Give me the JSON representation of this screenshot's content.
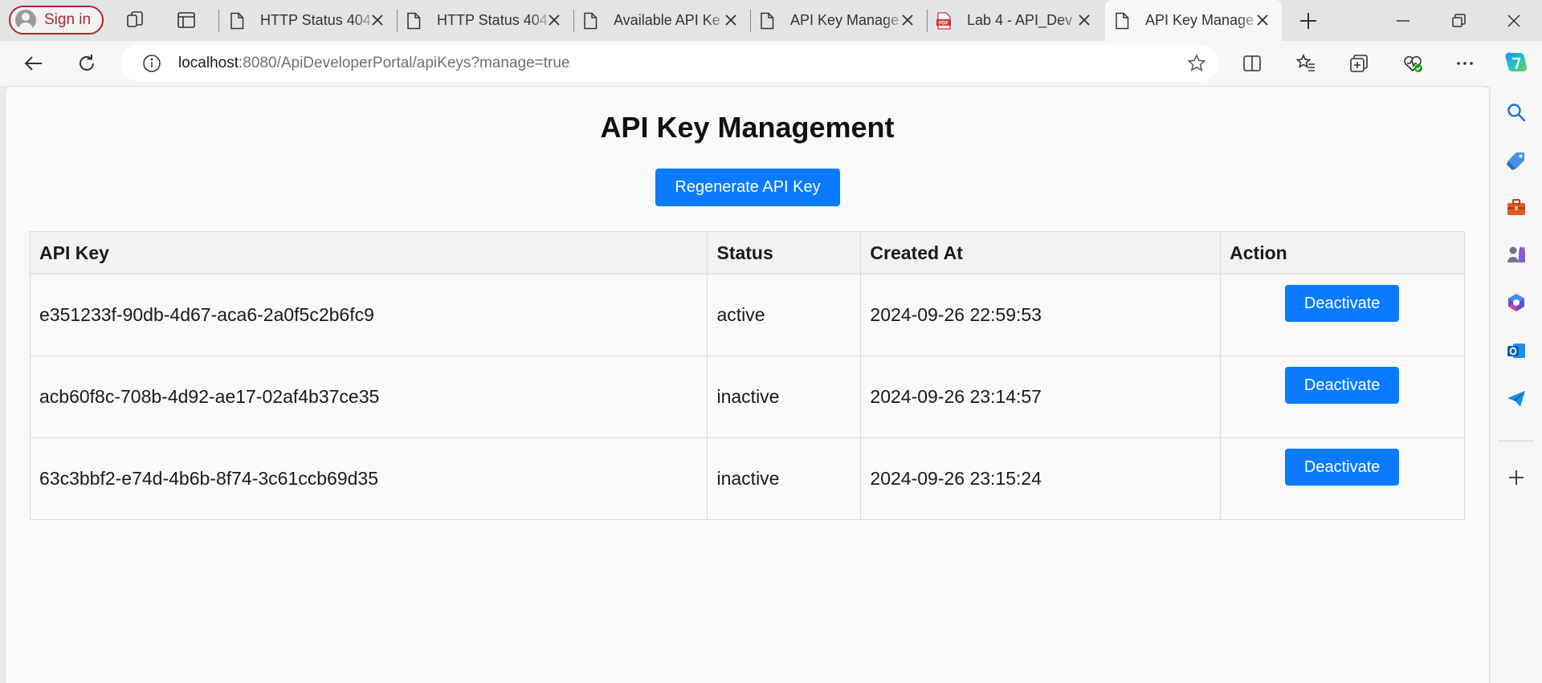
{
  "browser": {
    "profile_label": "Sign in",
    "tabs": [
      {
        "title": "HTTP Status 404",
        "icon": "page-icon"
      },
      {
        "title": "HTTP Status 404",
        "icon": "page-icon"
      },
      {
        "title": "Available API Ke",
        "icon": "page-icon"
      },
      {
        "title": "API Key Manage",
        "icon": "page-icon"
      },
      {
        "title": "Lab 4 - API_Dev",
        "icon": "pdf-icon"
      },
      {
        "title": "API Key Manage",
        "icon": "page-icon",
        "active": true
      }
    ],
    "url_host": "localhost",
    "url_rest": ":8080/ApiDeveloperPortal/apiKeys?manage=true",
    "pdf_badge": "PDF"
  },
  "page": {
    "title": "API Key Management",
    "regenerate_label": "Regenerate API Key",
    "table": {
      "headers": [
        "API Key",
        "Status",
        "Created At",
        "Action"
      ],
      "rows": [
        {
          "key": "e351233f-90db-4d67-aca6-2a0f5c2b6fc9",
          "status": "active",
          "created_at": "2024-09-26 22:59:53",
          "action": "Deactivate"
        },
        {
          "key": "acb60f8c-708b-4d92-ae17-02af4b37ce35",
          "status": "inactive",
          "created_at": "2024-09-26 23:14:57",
          "action": "Deactivate"
        },
        {
          "key": "63c3bbf2-e74d-4b6b-8f74-3c61ccb69d35",
          "status": "inactive",
          "created_at": "2024-09-26 23:15:24",
          "action": "Deactivate"
        }
      ]
    }
  },
  "colors": {
    "accent": "#0a7bff",
    "profile_border": "#b3262d"
  }
}
